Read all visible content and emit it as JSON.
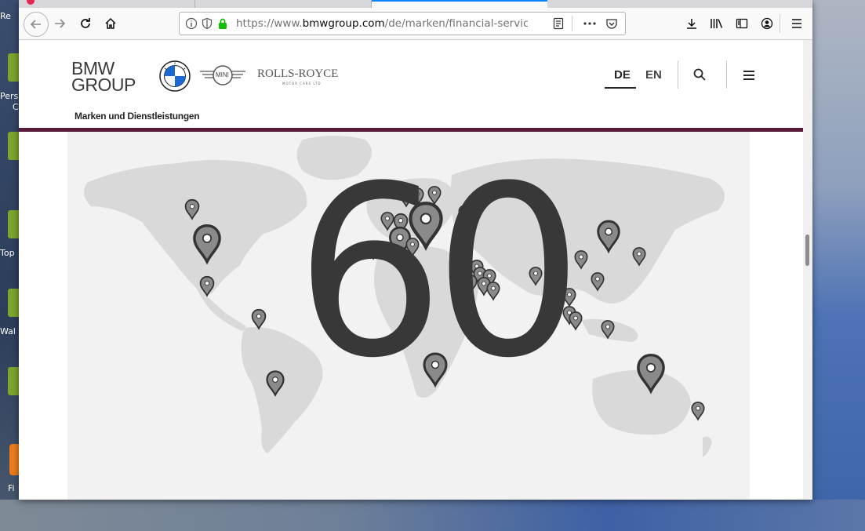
{
  "desktop": {
    "labels": [
      "Re",
      "Pers",
      "C",
      "Top",
      "Wal",
      "Fi"
    ]
  },
  "browser": {
    "url_prefix": "https://www.",
    "url_domain": "bmwgroup.com",
    "url_path": "/de/marken/financial-services.ht",
    "icons": {
      "back": "back-arrow-icon",
      "forward": "forward-arrow-icon",
      "reload": "reload-icon",
      "home": "home-icon",
      "info": "info-icon",
      "tracking": "shield-icon",
      "secure": "lock-icon",
      "reader": "reader-view-icon",
      "more": "more-icon",
      "pocket": "pocket-icon",
      "downloads": "download-icon",
      "library": "library-icon",
      "sidebar": "sidebar-icon",
      "account": "account-icon",
      "menu": "hamburger-menu-icon"
    }
  },
  "site": {
    "logo_line1": "BMW",
    "logo_line2": "GROUP",
    "mini_label": "MINI",
    "rr_label": "ROLLS-ROYCE",
    "rr_sub": "MOTOR CARS LTD",
    "lang_de": "DE",
    "lang_en": "EN",
    "nav_label": "Marken und Dienstleistungen",
    "accent_color": "#5a1b3b"
  },
  "hero": {
    "number": "60"
  }
}
